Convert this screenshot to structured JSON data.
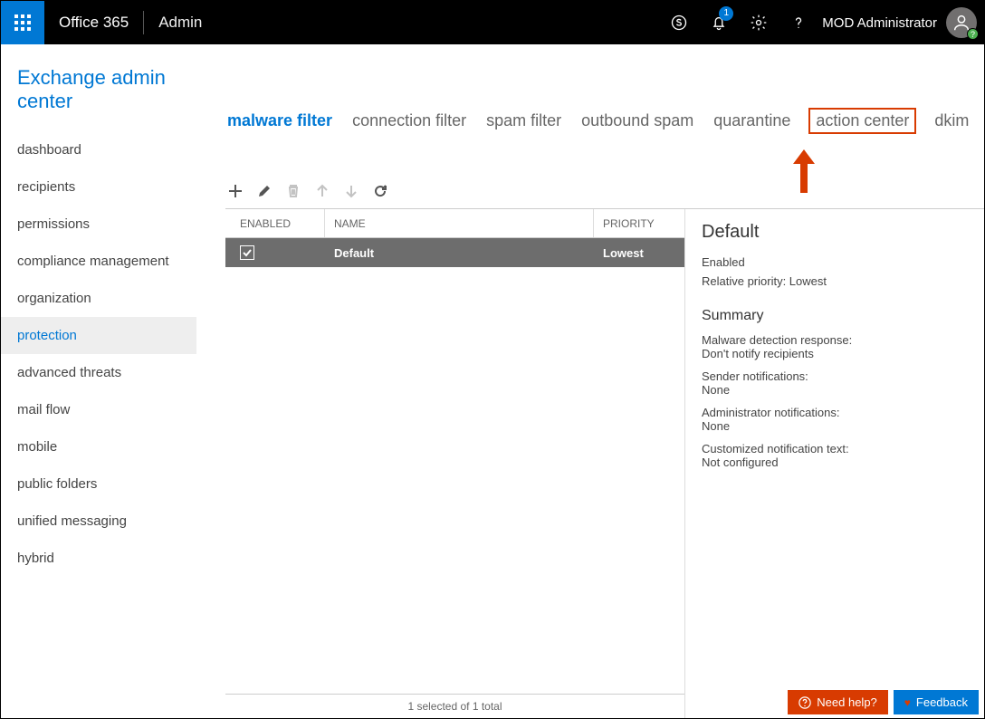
{
  "topbar": {
    "brand": "Office 365",
    "section": "Admin",
    "notification_count": "1",
    "username": "MOD Administrator"
  },
  "page_title": "Exchange admin center",
  "sidebar": {
    "items": [
      {
        "label": "dashboard"
      },
      {
        "label": "recipients"
      },
      {
        "label": "permissions"
      },
      {
        "label": "compliance management"
      },
      {
        "label": "organization"
      },
      {
        "label": "protection"
      },
      {
        "label": "advanced threats"
      },
      {
        "label": "mail flow"
      },
      {
        "label": "mobile"
      },
      {
        "label": "public folders"
      },
      {
        "label": "unified messaging"
      },
      {
        "label": "hybrid"
      }
    ],
    "active_index": 5
  },
  "tabs": {
    "items": [
      {
        "label": "malware filter"
      },
      {
        "label": "connection filter"
      },
      {
        "label": "spam filter"
      },
      {
        "label": "outbound spam"
      },
      {
        "label": "quarantine"
      },
      {
        "label": "action center"
      },
      {
        "label": "dkim"
      }
    ],
    "active_index": 0,
    "highlighted_index": 5
  },
  "grid": {
    "headers": {
      "enabled": "ENABLED",
      "name": "NAME",
      "priority": "PRIORITY"
    },
    "rows": [
      {
        "enabled": true,
        "name": "Default",
        "priority": "Lowest"
      }
    ],
    "footer": "1 selected of 1 total"
  },
  "details": {
    "title": "Default",
    "status": "Enabled",
    "relative_priority_label": "Relative priority: Lowest",
    "summary_heading": "Summary",
    "items": [
      {
        "k": "Malware detection response:",
        "v": "Don't notify recipients"
      },
      {
        "k": "Sender notifications:",
        "v": "None"
      },
      {
        "k": "Administrator notifications:",
        "v": "None"
      },
      {
        "k": "Customized notification text:",
        "v": "Not configured"
      }
    ]
  },
  "buttons": {
    "help": "Need help?",
    "feedback": "Feedback"
  }
}
